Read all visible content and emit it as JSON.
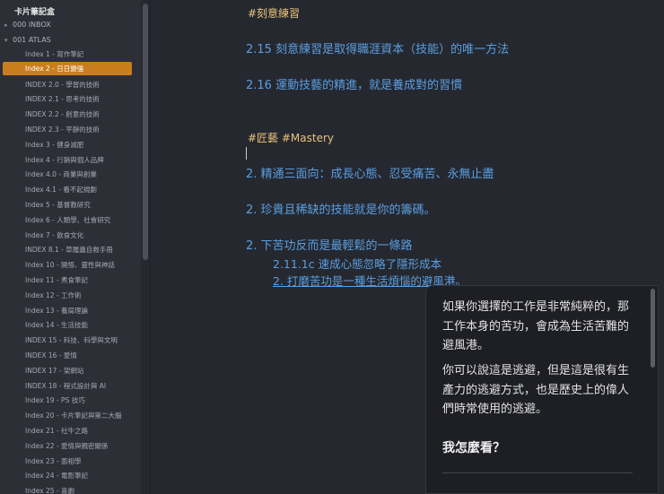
{
  "sidebar": {
    "vault_title": "卡片筆記盒",
    "folders": [
      "000 INBOX",
      "001 ATLAS"
    ],
    "items": [
      "Index 1 - 寫作筆記",
      "Index 2 - 日日變強",
      "INDEX 2.0 - 學習的技術",
      "INDEX 2.1 - 思考的技術",
      "INDEX 2.2 - 創意的技術",
      "INDEX 2.3 - 平靜的技術",
      "Index 3 - 健身減肥",
      "Index 4 - 行銷與個人品牌",
      "Index 4.0 - 商業與創業",
      "Index 4.1 - 看不起規劃",
      "Index 5 - 基督教研究",
      "Index 6 - 人類學、社會研究",
      "Index 7 - 飲食文化",
      "INDEX 8.1 - 草履蟲自救手冊",
      "Index 10 - 開悟、靈性與神話",
      "Index 11 - 煮食筆記",
      "Index 12 - 工作術",
      "Index 13 - 養局理論",
      "Index 14 - 生活技能",
      "INDEX 15 - 科技、科學與文明",
      "INDEX 16 - 愛情",
      "INDEX 17 - 架網站",
      "INDEX 18 - 程式設計與 AI",
      "Index 19 - PS 技巧",
      "Index 20 - 卡片筆記與第二大腦",
      "Index 21 - 社牛之路",
      "Index 22 - 愛情與親密關係",
      "Index 23 - 面相學",
      "Index 24 - 電影筆記",
      "Index 25 - 喜劇"
    ],
    "active_index": 1
  },
  "editor": {
    "tag1": "#刻意練習",
    "line1": "2.15 刻意練習是取得職涯資本（技能）的唯一方法",
    "line2": "2.16 運動技藝的精進，就是養成對的習慣",
    "tag2": "#匠藝  #Mastery",
    "line3": "2. 精通三面向：成長心態、忍受痛苦、永無止盡",
    "line4": "2. 珍貴且稀缺的技能就是你的籌碼。",
    "line5": "2. 下苦功反而是最輕鬆的一條路",
    "sub1": "2.11.1c 速成心態忽略了隱形成本",
    "sub2": "2. 打磨苦功是一種生活煩惱的避風港。"
  },
  "popover": {
    "para1": "如果你選擇的工作是非常純粹的，那工作本身的苦功，會成為生活苦難的避風港。",
    "para2": "你可以說這是逃避，但是這是很有生產力的逃避方式，也是歷史上的偉人們時常使用的逃避。",
    "heading": "我怎麼看？"
  },
  "colors": {
    "accent": "#c97e1e",
    "link": "#5a9fe0",
    "tag": "#e8c47a",
    "background": "#262830",
    "sidebar": "#2d2f37",
    "popover": "#1e1f24"
  }
}
